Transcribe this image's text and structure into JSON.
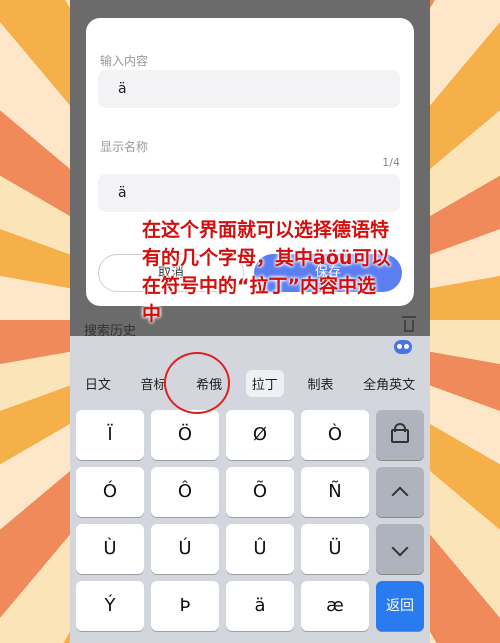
{
  "dialog": {
    "input_label": "输入内容",
    "input_value": "ä",
    "display_label": "显示名称",
    "counter": "1/4",
    "display_value": "ä",
    "cancel_label": "取消",
    "save_label": "保存"
  },
  "history": {
    "label": "搜索历史"
  },
  "keyboard": {
    "categories": [
      "日文",
      "音标",
      "希俄",
      "拉丁",
      "制表",
      "全角英文"
    ],
    "active_category": "拉丁",
    "keys": [
      [
        "Ï",
        "Ö",
        "Ø",
        "Ò"
      ],
      [
        "Ó",
        "Ô",
        "Õ",
        "Ñ"
      ],
      [
        "Ù",
        "Ú",
        "Û",
        "Ü"
      ],
      [
        "Ý",
        "Þ",
        "ä",
        "æ"
      ]
    ],
    "return_label": "返回"
  },
  "caption": "在这个界面就可以选择德语特有的几个字母，其中äöü可以在符号中的“拉丁”内容中选中",
  "colors": {
    "accent": "#5b7ff0",
    "return": "#2a7af0",
    "caption": "#d40d0d"
  }
}
